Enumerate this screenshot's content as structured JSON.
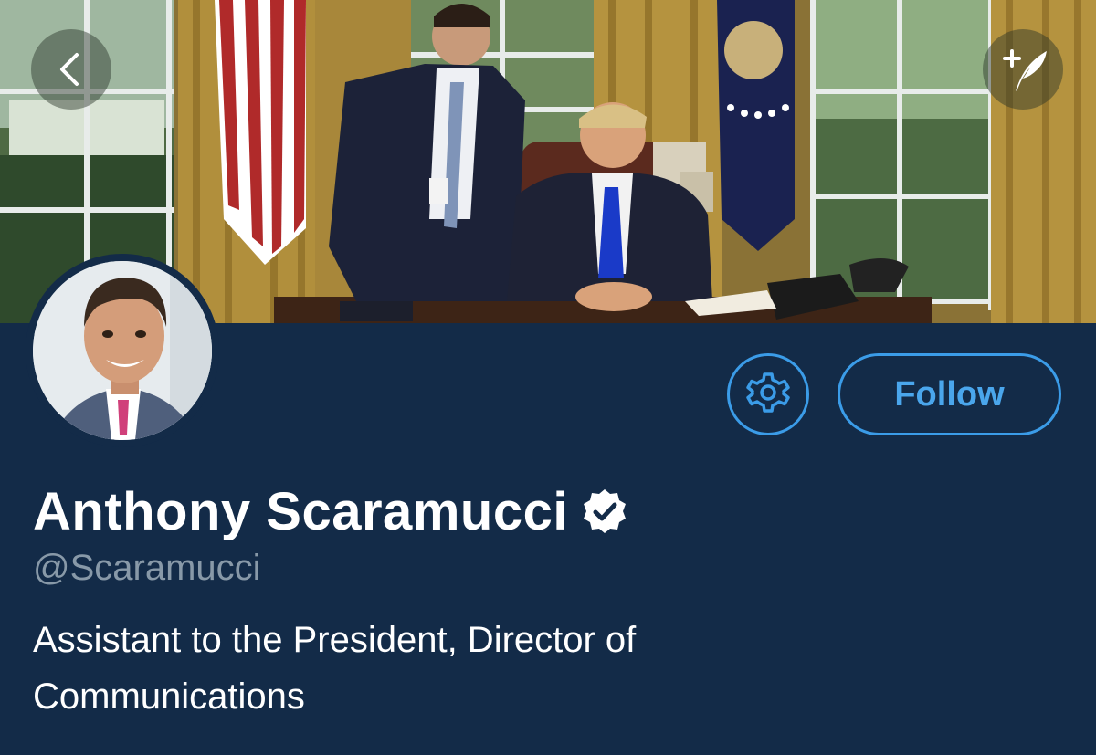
{
  "header": {
    "back_icon": "chevron-left-icon",
    "compose_icon": "compose-tweet-icon"
  },
  "profile": {
    "display_name": "Anthony Scaramucci",
    "verified_icon": "verified-badge-icon",
    "handle": "@Scaramucci",
    "bio": "Assistant to the President, Director of Communications"
  },
  "actions": {
    "settings_icon": "gear-icon",
    "follow_label": "Follow"
  },
  "colors": {
    "background": "#132b48",
    "accent": "#3b9ce8",
    "handle_text": "#8899a8",
    "name_text": "#ffffff"
  }
}
